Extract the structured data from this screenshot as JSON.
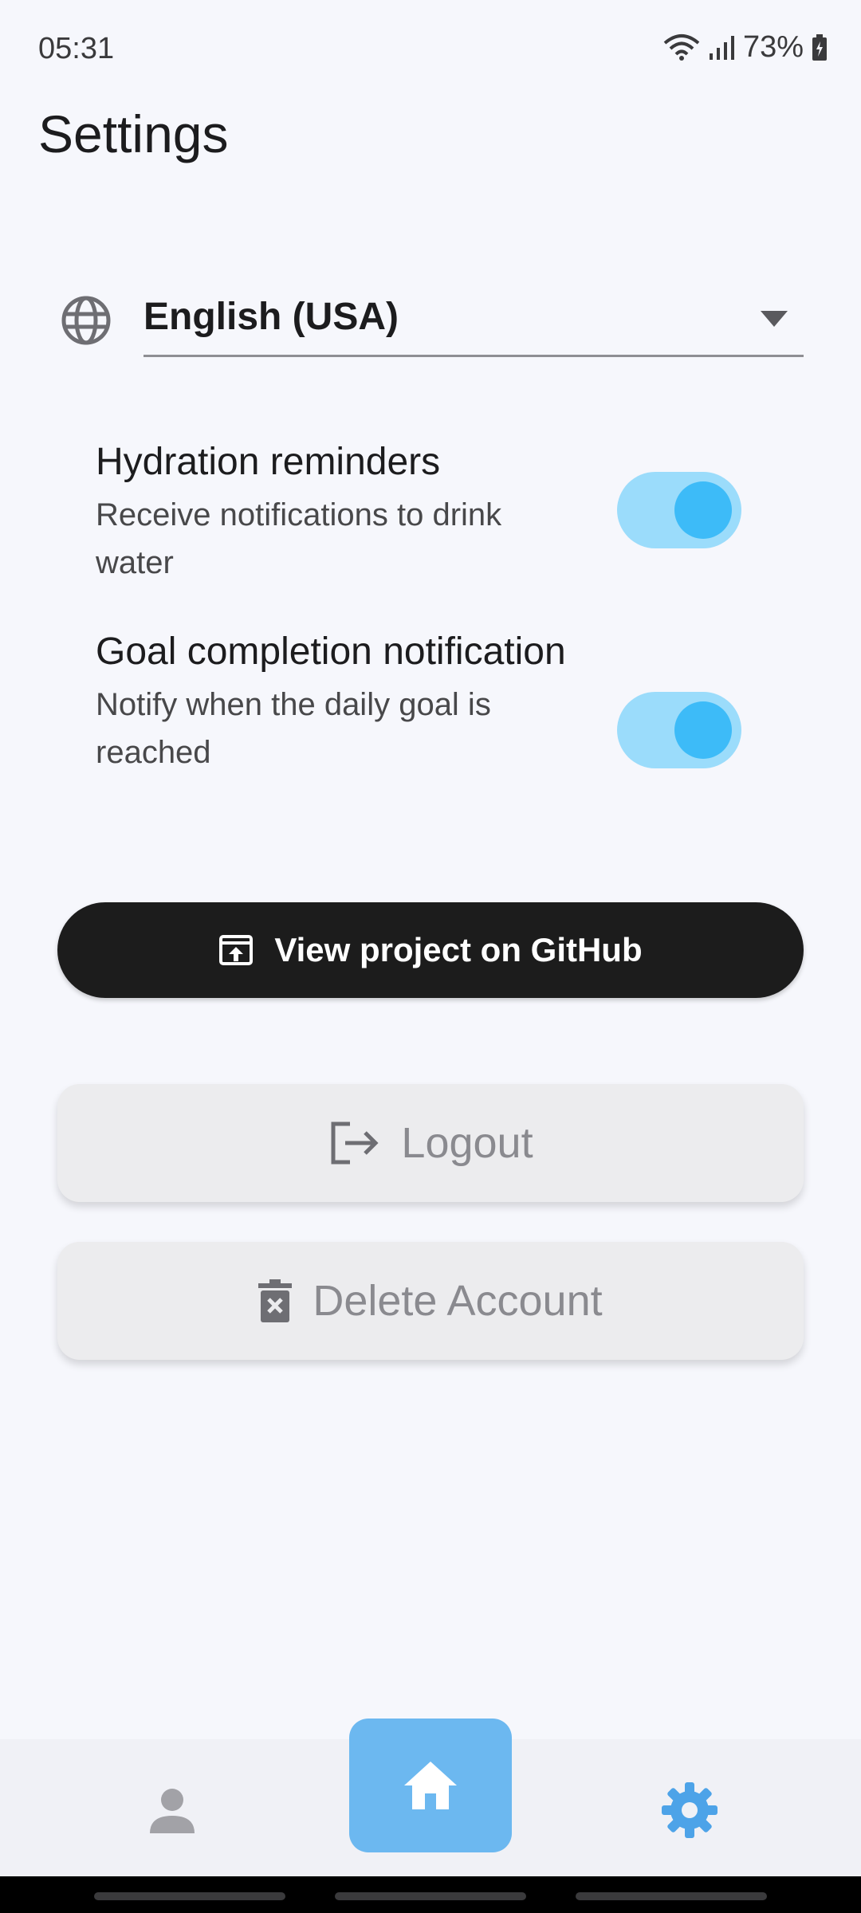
{
  "status_bar": {
    "time": "05:31",
    "battery": "73%",
    "icons": [
      "wifi-icon",
      "signal-icon",
      "battery-icon"
    ]
  },
  "page": {
    "title": "Settings"
  },
  "language": {
    "icon": "globe-icon",
    "selected": "English (USA)"
  },
  "toggles": [
    {
      "title": "Hydration reminders",
      "description": "Receive notifications to drink water",
      "enabled": true
    },
    {
      "title": "Goal completion notification",
      "description": "Notify when the daily goal is reached",
      "enabled": true
    }
  ],
  "buttons": {
    "github": "View project on GitHub",
    "logout": "Logout",
    "delete_account": "Delete Account"
  },
  "bottom_nav": {
    "items": [
      "profile",
      "home",
      "settings"
    ],
    "active": "home"
  },
  "colors": {
    "background": "#f6f7fc",
    "switch_track": "#9bdcfb",
    "switch_knob": "#3dbbf8",
    "github_button": "#1c1c1c",
    "nav_active": "#6cb8f0",
    "settings_icon": "#4da3e8"
  }
}
